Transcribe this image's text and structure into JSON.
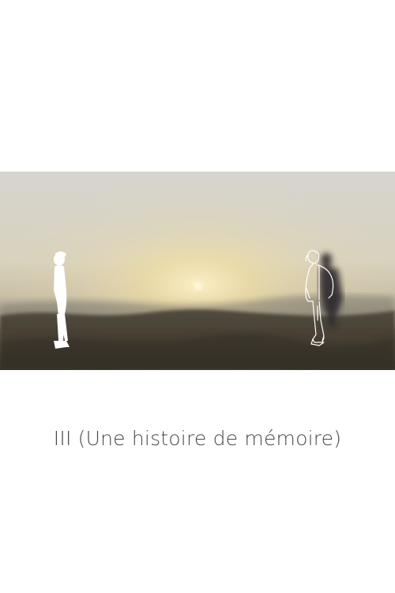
{
  "poster": {
    "title": "III (Une histoire de mémoire)"
  },
  "still": {
    "scene": "sunset-over-coastline",
    "colors": {
      "sky_top": "#d9d6cf",
      "sky_glow": "#f1e3b4",
      "sun": "#fff6d6",
      "horizon_haze": "#9a968c",
      "ground": "#4a4538",
      "ground_dark": "#36312a",
      "figure_solid": "#ffffff",
      "figure_line": "#ffffff",
      "silhouette": "#2d2a2c"
    }
  }
}
